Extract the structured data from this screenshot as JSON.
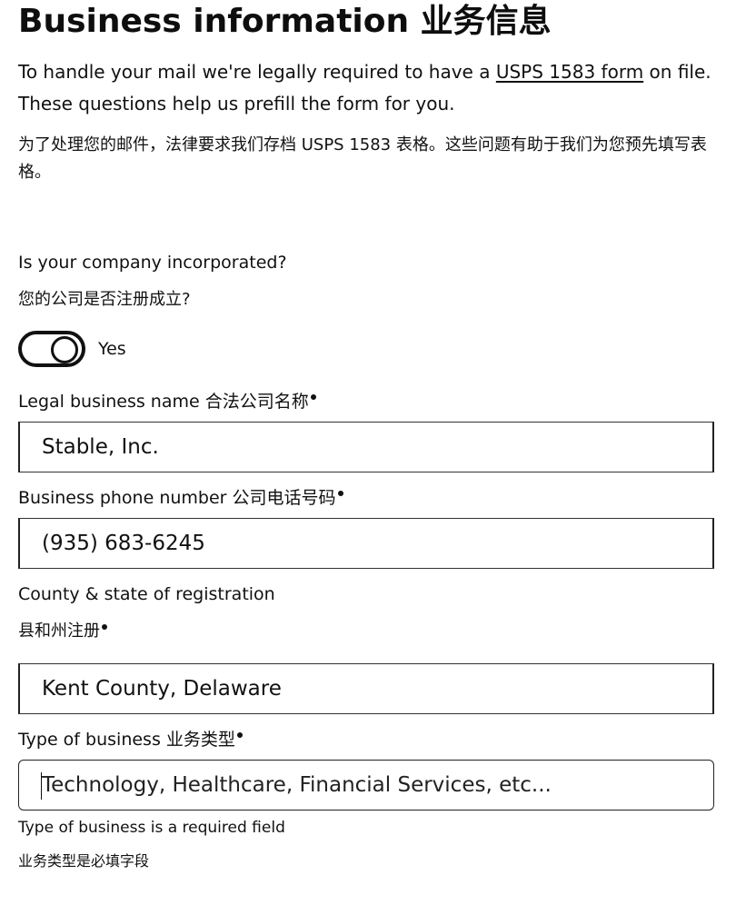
{
  "header": {
    "title": "Business information 业务信息"
  },
  "intro": {
    "en_before_link": "To handle your mail we're legally required to have a ",
    "link_text": "USPS 1583 form",
    "en_after_link": " on file. These questions help us prefill the form for you.",
    "zh": "为了处理您的邮件，法律要求我们存档 USPS 1583 表格。这些问题有助于我们为您预先填写表格。"
  },
  "incorporated": {
    "question_en": "Is your company incorporated?",
    "question_zh": "您的公司是否注册成立?",
    "toggle_on": true,
    "toggle_label": "Yes"
  },
  "fields": {
    "legal_name": {
      "label": "Legal business name 合法公司名称",
      "value": "Stable, Inc."
    },
    "phone": {
      "label": "Business phone number 公司电话号码",
      "value": "(935) 683-6245"
    },
    "registration": {
      "label_en": "County & state of registration",
      "label_zh": "县和州注册",
      "value": "Kent County, Delaware"
    },
    "business_type": {
      "label": "Type of business 业务类型",
      "placeholder": "Technology, Healthcare, Financial Services, etc...",
      "error_en": "Type of business is a required field",
      "error_zh": "业务类型是必填字段"
    }
  }
}
